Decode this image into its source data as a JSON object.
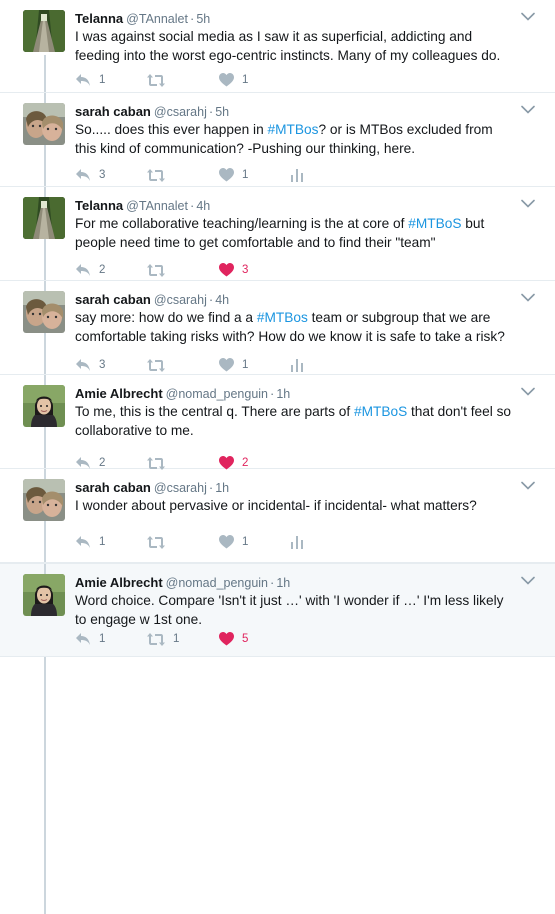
{
  "tweets": [
    {
      "name": "Telanna",
      "handle": "@TAnnalet",
      "time": "5h",
      "segments": [
        {
          "text": "I was against social media as I saw it as superficial, addicting and feeding into the worst ego-centric instincts. Many of my colleagues do.",
          "hashtag": false
        }
      ],
      "replies": "1",
      "retweets": "",
      "likes": "1",
      "liked": false,
      "analytics": false,
      "avatar": "forest-bridge"
    },
    {
      "name": "sarah caban",
      "handle": "@csarahj",
      "time": "5h",
      "segments": [
        {
          "text": "So..... does this ever happen in ",
          "hashtag": false
        },
        {
          "text": "#MTBos",
          "hashtag": true
        },
        {
          "text": "? or is MTBos excluded from this kind of communication? -Pushing our thinking, here.",
          "hashtag": false
        }
      ],
      "replies": "3",
      "retweets": "",
      "likes": "1",
      "liked": false,
      "analytics": true,
      "avatar": "selfie"
    },
    {
      "name": "Telanna",
      "handle": "@TAnnalet",
      "time": "4h",
      "segments": [
        {
          "text": "For me collaborative teaching/learning is the at core of ",
          "hashtag": false
        },
        {
          "text": "#MTBoS",
          "hashtag": true
        },
        {
          "text": " but people need time to get comfortable and to find their \"team\"",
          "hashtag": false
        }
      ],
      "replies": "2",
      "retweets": "",
      "likes": "3",
      "liked": true,
      "analytics": false,
      "avatar": "forest-bridge"
    },
    {
      "name": "sarah caban",
      "handle": "@csarahj",
      "time": "4h",
      "segments": [
        {
          "text": "say more:  how do we find a a ",
          "hashtag": false
        },
        {
          "text": "#MTBos",
          "hashtag": true
        },
        {
          "text": " team or subgroup that we are comfortable taking risks with? How do we know it is safe to take a risk?",
          "hashtag": false
        }
      ],
      "replies": "3",
      "retweets": "",
      "likes": "1",
      "liked": false,
      "analytics": true,
      "avatar": "selfie"
    },
    {
      "name": "Amie Albrecht",
      "handle": "@nomad_penguin",
      "time": "1h",
      "segments": [
        {
          "text": "To me, this is the central q. There are parts of ",
          "hashtag": false
        },
        {
          "text": "#MTBoS",
          "hashtag": true
        },
        {
          "text": " that don't feel so collaborative to me.",
          "hashtag": false
        }
      ],
      "replies": "2",
      "retweets": "",
      "likes": "2",
      "liked": true,
      "analytics": false,
      "avatar": "portrait"
    },
    {
      "name": "sarah caban",
      "handle": "@csarahj",
      "time": "1h",
      "segments": [
        {
          "text": "I wonder about pervasive or incidental- if incidental- what matters?",
          "hashtag": false
        }
      ],
      "replies": "1",
      "retweets": "",
      "likes": "1",
      "liked": false,
      "analytics": true,
      "avatar": "selfie"
    },
    {
      "name": "Amie Albrecht",
      "handle": "@nomad_penguin",
      "time": "1h",
      "segments": [
        {
          "text": "Word choice. Compare 'Isn't it just …' with 'I wonder if …' I'm less likely to engage w 1st one.",
          "hashtag": false
        }
      ],
      "replies": "1",
      "retweets": "1",
      "likes": "5",
      "liked": true,
      "analytics": false,
      "avatar": "portrait"
    }
  ],
  "separator": "·",
  "icons": {
    "reply": "reply-icon",
    "retweet": "retweet-icon",
    "like": "heart-icon",
    "analytics": "analytics-icon",
    "more": "chevron-down-icon"
  },
  "colors": {
    "icon": "#aab8c2",
    "liked": "#e0245e",
    "hashtag": "#1b95e0",
    "thread_line": "#ccd6dd",
    "highlight_bg": "#f5f8fa"
  }
}
